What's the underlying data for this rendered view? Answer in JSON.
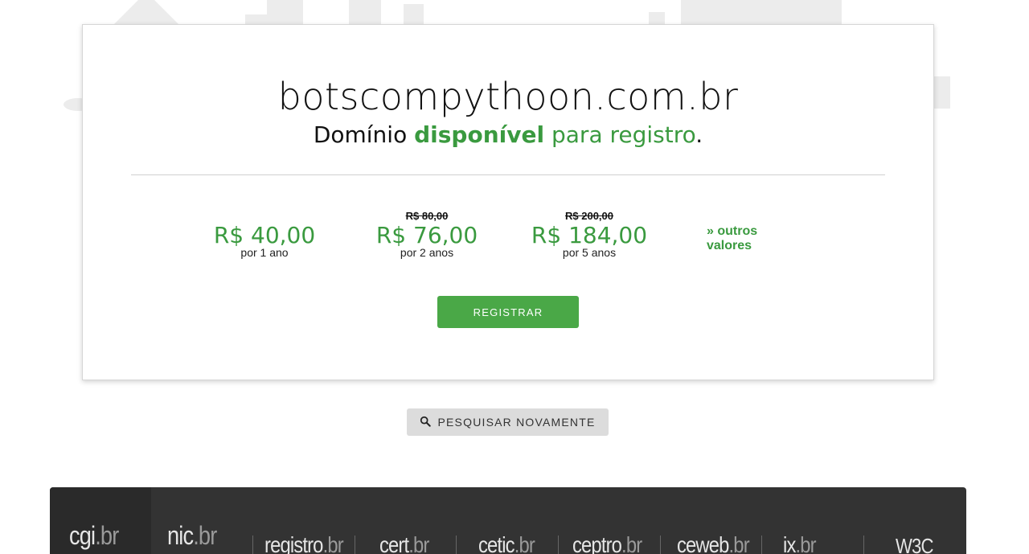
{
  "result": {
    "domain": "botscompythoon.com.br",
    "status_prefix": "Domínio",
    "status_word": "disponível",
    "status_suffix": "para registro",
    "status_period": "."
  },
  "prices": [
    {
      "old": "",
      "value": "R$ 40,00",
      "term": "por 1 ano"
    },
    {
      "old": "R$ 80,00",
      "value": "R$ 76,00",
      "term": "por 2 anos"
    },
    {
      "old": "R$ 200,00",
      "value": "R$ 184,00",
      "term": "por 5 anos"
    }
  ],
  "other_values_label": "» outros valores",
  "register_label": "REGISTRAR",
  "search_again_label": "PESQUISAR NOVAMENTE",
  "footer": {
    "logos": [
      {
        "name": "cgi",
        "text": "cgi",
        "suffix": ".br"
      },
      {
        "name": "nic",
        "text": "nic",
        "suffix": ".br"
      },
      {
        "name": "registro",
        "text": "registro",
        "suffix": ".br"
      },
      {
        "name": "cert",
        "text": "cert",
        "suffix": ".br"
      },
      {
        "name": "cetic",
        "text": "cetic",
        "suffix": ".br"
      },
      {
        "name": "ceptro",
        "text": "ceptro",
        "suffix": ".br"
      },
      {
        "name": "ceweb",
        "text": "ceweb",
        "suffix": ".br"
      },
      {
        "name": "ix",
        "text": "ix",
        "suffix": ".br"
      },
      {
        "name": "w3c",
        "text": "W3C",
        "suffix": ""
      }
    ]
  },
  "colors": {
    "accent_green": "#3a9a3f",
    "button_green": "#4aa847",
    "footer_bg": "#333333"
  }
}
